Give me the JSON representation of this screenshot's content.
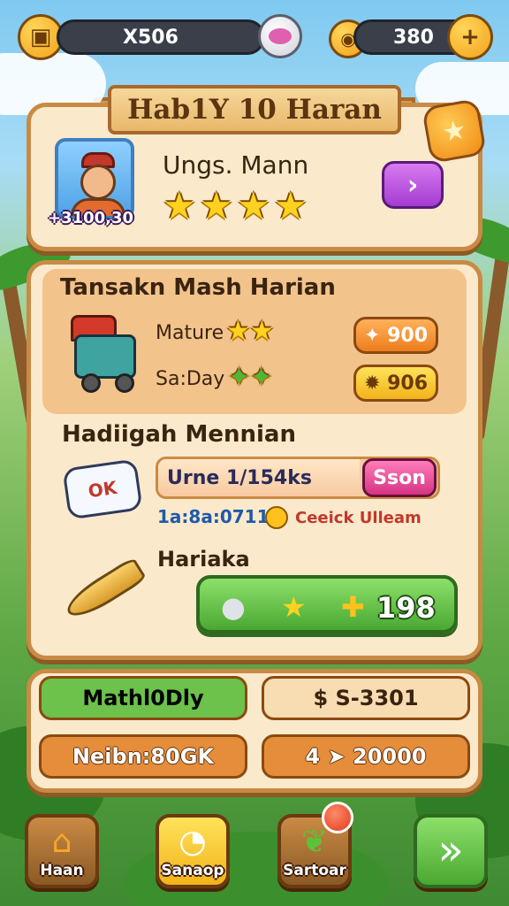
{
  "top_bar": {
    "left_counter": "X506",
    "right_counter": "380",
    "add_label": "+"
  },
  "profile_card": {
    "banner_title": "Hab1Y 10 Haran",
    "name": "Ungs. Mann",
    "portrait_badge": "+3100,30",
    "stars": [
      "★",
      "★",
      "★",
      "★"
    ],
    "arrow_label": "›"
  },
  "daily_tasks": {
    "title": "Tansakn Mash Harian",
    "rows": [
      {
        "label": "Mature",
        "stars": "★★",
        "reward": "✦ 900"
      },
      {
        "label": "Sa:Day",
        "stars": "✦✦",
        "reward": "✹ 906"
      }
    ]
  },
  "daily_gift": {
    "title": "Hadiigah Mennian",
    "icon_text": "OK",
    "progress_text": "Urne 1/154ks",
    "progress_fraction": 0.72,
    "claim_label": "Sson",
    "sub_left": "1a:8a:0711",
    "sub_right": "Ceeick Ulleam"
  },
  "hariaka": {
    "title": "Hariaka",
    "items": [
      "●",
      "★",
      "✚"
    ],
    "value": "198"
  },
  "stats": [
    {
      "label": "Mathl0Dly",
      "color": "#6cc24a"
    },
    {
      "label": "$  S-3301",
      "color": "#f8dcb2"
    },
    {
      "label": "Neibn:80GK",
      "color": "#e58d3a"
    },
    {
      "label": "4 ➤ 20000",
      "color": "#e58d3a"
    }
  ],
  "nav": {
    "home": "Haan",
    "shop": "Sanaop",
    "social": "Sartoar",
    "next": "»"
  }
}
